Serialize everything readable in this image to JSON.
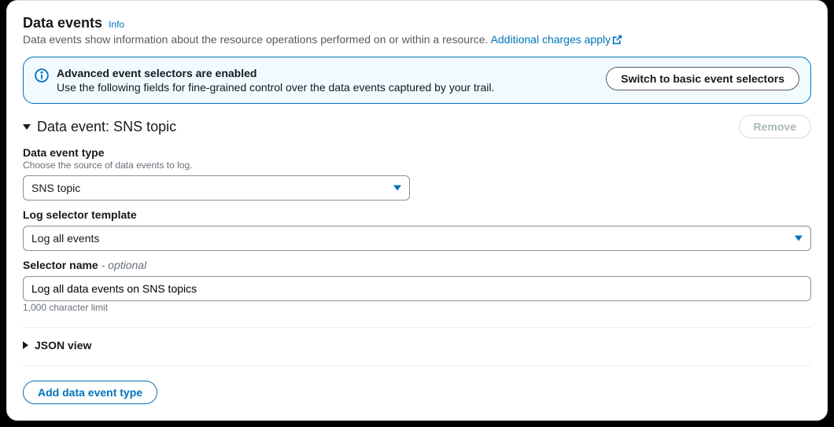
{
  "header": {
    "title": "Data events",
    "info": "Info",
    "desc": "Data events show information about the resource operations performed on or within a resource. ",
    "charges_link": "Additional charges apply"
  },
  "alert": {
    "title": "Advanced event selectors are enabled",
    "desc": "Use the following fields for fine-grained control over the data events captured by your trail.",
    "switch_btn": "Switch to basic event selectors"
  },
  "section": {
    "title": "Data event: SNS topic",
    "remove_btn": "Remove"
  },
  "field_type": {
    "label": "Data event type",
    "hint": "Choose the source of data events to log.",
    "value": "SNS topic"
  },
  "field_template": {
    "label": "Log selector template",
    "value": "Log all events"
  },
  "field_name": {
    "label": "Selector name",
    "optional": " - optional",
    "value": "Log all data events on SNS topics",
    "hint": "1,000 character limit"
  },
  "json_view": "JSON view",
  "add_btn": "Add data event type"
}
